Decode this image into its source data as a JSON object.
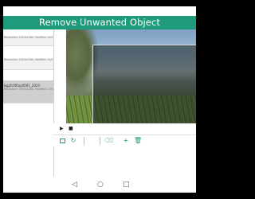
{
  "app": {
    "title": "Remove Unwanted Object"
  },
  "files": [
    {
      "name": "",
      "meta": "Resolution: 1920x1080, Modified: 04/11/2017",
      "selected": false
    },
    {
      "name": "",
      "meta": "Resolution: 1920x1080, Modified: 04/11/2017",
      "selected": false
    },
    {
      "name": "bggfc0f0xp0001_2020",
      "meta": "Resolution: 1920x1080, Modified: 23/05/2017",
      "selected": true
    }
  ],
  "player": {
    "play_icon": "play-icon",
    "stop_icon": "stop-icon"
  },
  "toolbar": {
    "icons": [
      "frame-select-icon",
      "replay-icon",
      "separator",
      "erase-icon",
      "add-icon",
      "delete-icon"
    ]
  },
  "navbar": {
    "back": "◁",
    "home": "○",
    "recents": "□"
  },
  "colors": {
    "accent": "#1f9a7a",
    "selection": "#cfcfcf"
  }
}
